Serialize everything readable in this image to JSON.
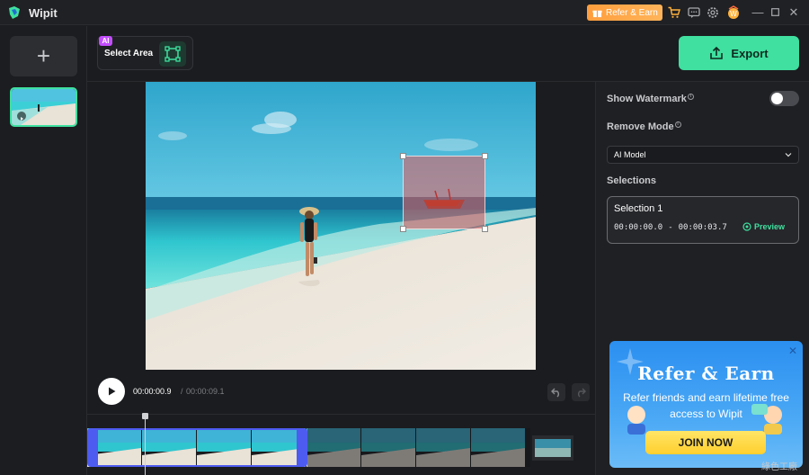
{
  "app": {
    "name": "Wipit"
  },
  "titlebar": {
    "refer_label": "Refer & Earn"
  },
  "toolbar": {
    "ai_badge": "AI",
    "select_area_label": "Select Area",
    "export_label": "Export"
  },
  "settings": {
    "show_watermark_label": "Show Watermark",
    "show_watermark_enabled": false,
    "remove_mode_label": "Remove Mode",
    "remove_mode_value": "AI Model",
    "selections_label": "Selections",
    "selection": {
      "title": "Selection 1",
      "start": "00:00:00.0",
      "separator": "-",
      "end": "00:00:03.7",
      "preview_label": "Preview"
    }
  },
  "playback": {
    "current_time": "00:00:00.9",
    "separator": "/",
    "total_time": "00:00:09.1"
  },
  "promo": {
    "title": "Refer & Earn",
    "subtitle": "Refer friends and earn lifetime free access to Wipit",
    "button": "JOIN NOW"
  },
  "watermark": "綠色工廠",
  "colors": {
    "accent": "#3fe0a0",
    "range": "#4d5bf0",
    "refer": "#ff9e3d",
    "selection_box": "#e65a5a"
  }
}
